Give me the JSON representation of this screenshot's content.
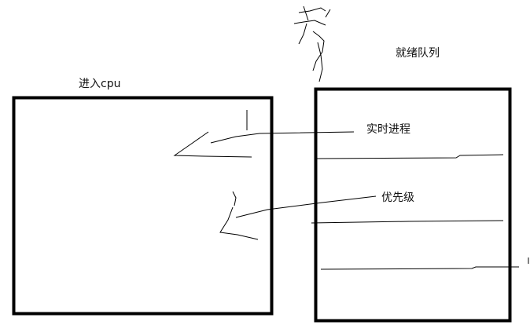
{
  "labels": {
    "cpu_box": "进入cpu",
    "ready_queue": "就绪队列",
    "realtime_process": "实时进程",
    "priority": "优先级"
  },
  "colors": {
    "background": "#ffffff",
    "ink": "#000000"
  }
}
